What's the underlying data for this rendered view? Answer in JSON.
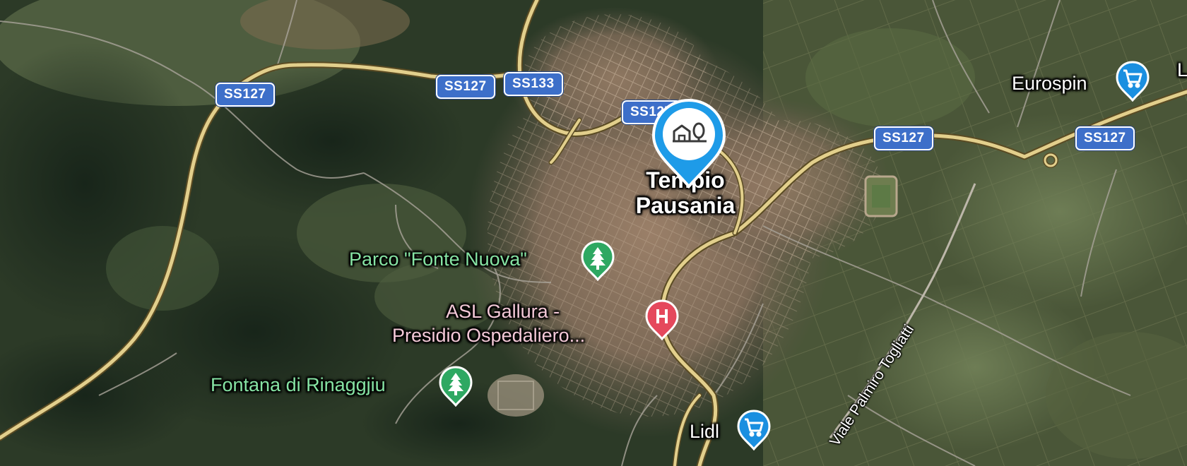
{
  "map": {
    "view": "satellite",
    "colors": {
      "shield_blue": "#3d6fc9",
      "pin_blue": "#1e9be8",
      "park_green": "#2ea862",
      "hospital_red": "#e5485c",
      "shop_blue": "#1a8fe0",
      "main_road": "#e2cf8c"
    }
  },
  "road_shields": [
    {
      "id": "ss127-west",
      "label": "SS127"
    },
    {
      "id": "ss127-center",
      "label": "SS127"
    },
    {
      "id": "ss133",
      "label": "SS133"
    },
    {
      "id": "ss127-town",
      "label": "SS127"
    },
    {
      "id": "ss127-east",
      "label": "SS127"
    },
    {
      "id": "ss127-far-east",
      "label": "SS127"
    }
  ],
  "city": {
    "name_line1": "Tempio",
    "name_line2": "Pausania",
    "pin_icon": "house-tree-icon"
  },
  "places": {
    "parco": {
      "label": "Parco \"Fonte Nuova\"",
      "icon": "tree-icon"
    },
    "asl": {
      "line1": "ASL Gallura -",
      "line2": "Presidio Ospedaliero...",
      "icon": "hospital-icon"
    },
    "fontana": {
      "label": "Fontana di Rinaggjiu",
      "icon": "tree-icon"
    },
    "lidl": {
      "label": "Lidl",
      "icon": "shopping-cart-icon"
    },
    "eurospin": {
      "label": "Eurospin",
      "icon": "shopping-cart-icon"
    },
    "edge_label": {
      "label": "L"
    }
  },
  "road_names": {
    "viale": "Viale Palmiro Togliatti"
  }
}
